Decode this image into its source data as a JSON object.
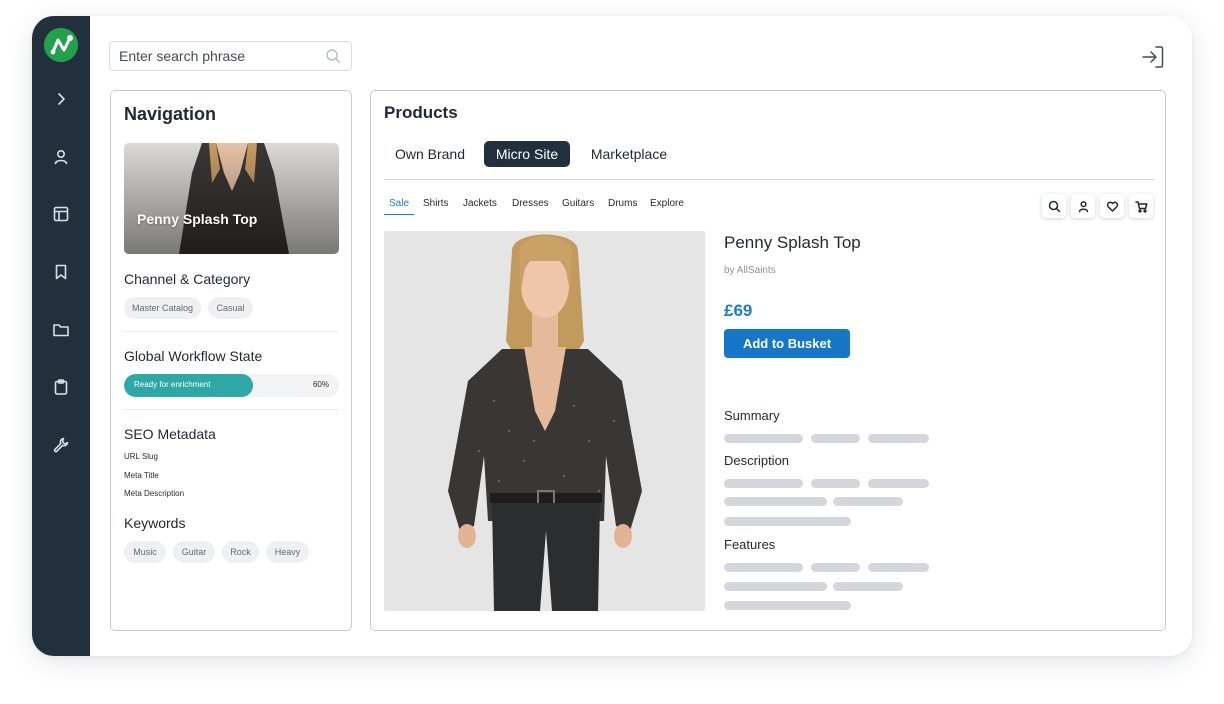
{
  "search": {
    "placeholder": "Enter search phrase"
  },
  "sidebar": {
    "items": [
      {
        "icon": "chevron-right-icon"
      },
      {
        "icon": "user-icon"
      },
      {
        "icon": "layout-icon"
      },
      {
        "icon": "bookmark-icon"
      },
      {
        "icon": "folder-icon"
      },
      {
        "icon": "clipboard-icon"
      },
      {
        "icon": "wrench-icon"
      }
    ]
  },
  "navigation": {
    "title": "Navigation",
    "thumbnail_title": "Penny Splash Top",
    "channel_label": "Channel & Category",
    "channel_chips": [
      "Master Catalog",
      "Casual"
    ],
    "workflow_label": "Global Workflow State",
    "workflow_status": "Ready for enrichment",
    "workflow_progress": 0.6,
    "workflow_percent": "60%",
    "seo_label": "SEO Metadata",
    "seo_fields": [
      "URL Slug",
      "Meta Title",
      "Meta Description"
    ],
    "keywords_label": "Keywords",
    "keywords": [
      "Music",
      "Guitar",
      "Rock",
      "Heavy"
    ]
  },
  "products": {
    "title": "Products",
    "tabs": [
      "Own Brand",
      "Micro Site",
      "Marketplace"
    ],
    "active_tab": "Micro Site",
    "subnav": [
      "Sale",
      "Shirts",
      "Jackets",
      "Dresses",
      "Guitars",
      "Drums",
      "Explore"
    ],
    "active_subnav": "Sale",
    "tools": [
      "search-icon",
      "user-icon",
      "heart-icon",
      "cart-icon"
    ],
    "product": {
      "name": "Penny Splash Top",
      "brand": "by AllSaints",
      "price": "£69",
      "add_button": "Add to Busket",
      "sections": [
        "Summary",
        "Description",
        "Features"
      ]
    }
  },
  "colors": {
    "sidebar": "#22303d",
    "accent": "#1677c9",
    "progress": "#2ea8a6",
    "logo": "#22a04a"
  }
}
